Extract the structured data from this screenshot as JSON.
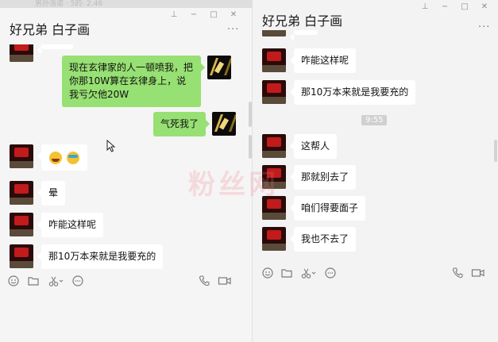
{
  "background_caption": "男孙浩诺 · 5的· 2.46",
  "watermark": "粉丝网",
  "left_window": {
    "title": "好兄弟 白子画",
    "more": "···",
    "messages": [
      {
        "dir": "out",
        "avatar": "gold",
        "text": "现在玄律家的人一顿喷我，把你那10W算在玄律身上，说我亏欠他20W"
      },
      {
        "dir": "out",
        "avatar": "gold",
        "text": "气死我了"
      },
      {
        "dir": "in",
        "avatar": "red",
        "emoji": [
          "laughing-crying-emoji",
          "crying-emoji"
        ]
      },
      {
        "dir": "in",
        "avatar": "red",
        "text": "晕"
      },
      {
        "dir": "in",
        "avatar": "red",
        "text": "咋能这样呢"
      },
      {
        "dir": "in",
        "avatar": "red",
        "text": "那10万本来就是我要充的"
      }
    ]
  },
  "right_window": {
    "title": "好兄弟 白子画",
    "more": "···",
    "timestamp": "9:55",
    "messages": [
      {
        "dir": "in",
        "avatar": "red",
        "text": "咋能这样呢"
      },
      {
        "dir": "in",
        "avatar": "red",
        "text": "那10万本来就是我要充的"
      },
      {
        "dir": "in",
        "avatar": "red",
        "text": "这帮人"
      },
      {
        "dir": "in",
        "avatar": "red",
        "text": "那就别去了"
      },
      {
        "dir": "in",
        "avatar": "red",
        "text": "咱们得要面子"
      },
      {
        "dir": "in",
        "avatar": "red",
        "text": "我也不去了"
      }
    ]
  },
  "window_controls": [
    "pin-icon",
    "minimize-icon",
    "maximize-icon",
    "close-icon"
  ],
  "toolbar_icons": [
    "emoji-icon",
    "folder-icon",
    "scissors-icon",
    "chat-bubble-icon",
    "phone-icon",
    "video-icon"
  ],
  "colors": {
    "outgoing_bubble": "#97e073",
    "incoming_bubble": "#ffffff",
    "window_bg": "#f5f5f5"
  }
}
